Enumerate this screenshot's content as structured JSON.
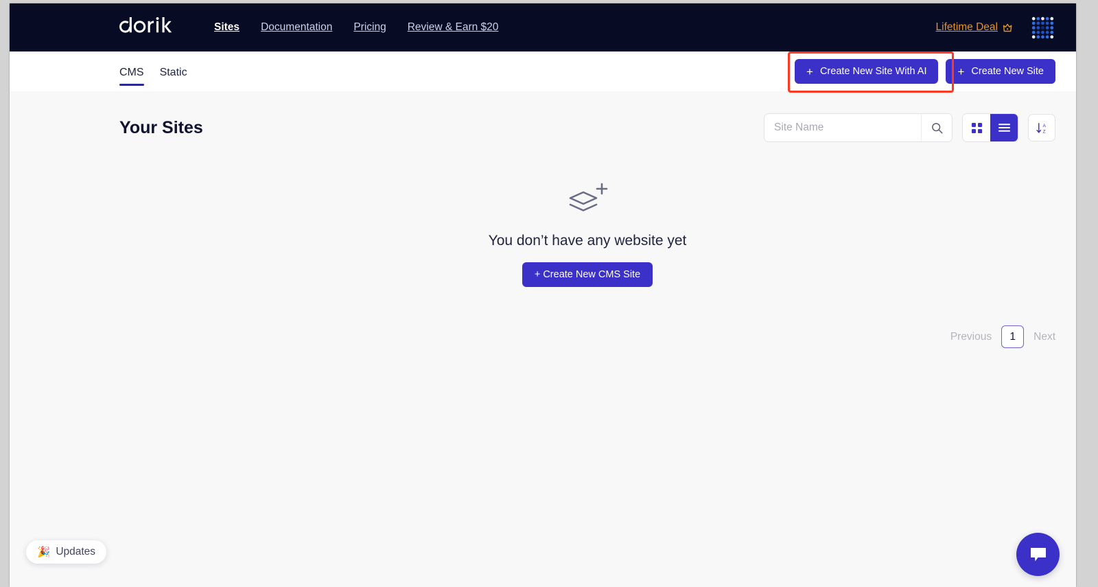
{
  "navbar": {
    "logo_text": "dorik",
    "links": [
      {
        "label": "Sites",
        "active": true
      },
      {
        "label": "Documentation",
        "active": false
      },
      {
        "label": "Pricing",
        "active": false
      },
      {
        "label": "Review & Earn $20",
        "active": false
      }
    ],
    "lifetime_deal_label": "Lifetime Deal",
    "lifetime_deal_color": "#e8921f",
    "crown_icon": "crown-icon",
    "avatar_icon": "identicon-avatar"
  },
  "tabbar": {
    "tabs": [
      {
        "label": "CMS",
        "active": true
      },
      {
        "label": "Static",
        "active": false
      }
    ],
    "create_with_ai_label": "Create New Site With AI",
    "create_site_label": "Create New Site",
    "plus_glyph": "+",
    "highlight_color": "#fb3a23",
    "primary_color": "#3b31c9"
  },
  "main": {
    "page_title": "Your Sites",
    "search": {
      "placeholder": "Site Name",
      "value": "",
      "icon": "search-icon"
    },
    "view_toggle": {
      "grid_icon": "grid-view-icon",
      "list_icon": "list-view-icon",
      "active": "list"
    },
    "sort": {
      "icon": "sort-az-icon",
      "label": "A\nZ"
    },
    "empty_state": {
      "icon": "layers-plus-icon",
      "message": "You don’t have any website yet",
      "button_label": "+ Create New CMS Site"
    },
    "pagination": {
      "previous_label": "Previous",
      "current_page": "1",
      "next_label": "Next"
    }
  },
  "floating": {
    "updates_label": "Updates",
    "updates_emoji": "🎉",
    "chat_icon": "chat-bubble-icon"
  }
}
